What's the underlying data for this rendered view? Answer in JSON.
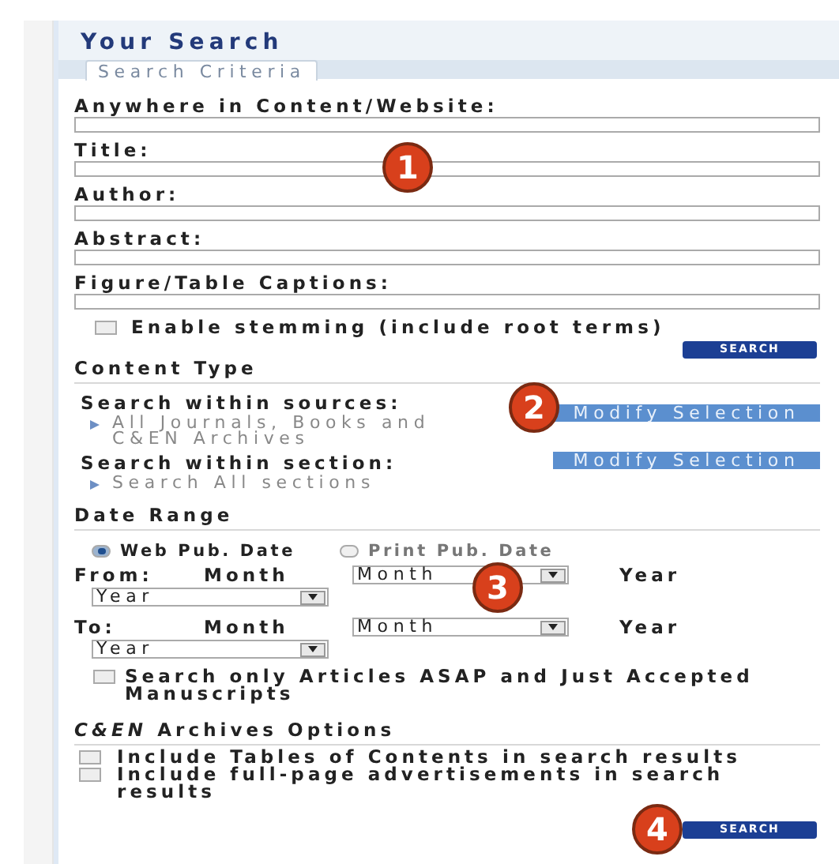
{
  "header": {
    "title": "Your Search"
  },
  "tabs": [
    {
      "label": "Search Criteria",
      "selected": true
    }
  ],
  "fields": [
    {
      "label": "Anywhere in Content/Website:"
    },
    {
      "label": "Title:"
    },
    {
      "label": "Author:"
    },
    {
      "label": "Abstract:"
    },
    {
      "label": "Figure/Table Captions:"
    }
  ],
  "stemming": {
    "label": "Enable stemming (include root terms)",
    "checked": false
  },
  "search_button": "SEARCH",
  "content_type": {
    "heading": "Content Type",
    "groups": [
      {
        "label": "Search within sources:",
        "button": "Modify Selection",
        "items": [
          "All Journals, Books and C&EN Archives"
        ]
      },
      {
        "label": "Search within section:",
        "button": "Modify Selection",
        "items": [
          "Search All sections"
        ]
      }
    ]
  },
  "date_range": {
    "heading": "Date Range",
    "radios": [
      {
        "label": "Web Pub. Date",
        "selected": true
      },
      {
        "label": "Print Pub. Date",
        "selected": false
      }
    ],
    "rows": [
      {
        "label": "From:",
        "month_label": "Month",
        "month_value": "Month",
        "year_label": "Year",
        "year_value": "Year"
      },
      {
        "label": "To:",
        "month_label": "Month",
        "month_value": "Month",
        "year_label": "Year",
        "year_value": "Year"
      }
    ]
  },
  "asap": {
    "label": "Search only Articles ASAP and Just Accepted Manuscripts",
    "checked": false
  },
  "archives": {
    "heading": "*C&EN* Archives Options",
    "options": [
      {
        "label": "Include Tables of Contents in search results",
        "checked": false
      },
      {
        "label": "Include full-page advertisements in search results",
        "checked": false
      }
    ]
  },
  "bottom_search_button": "SEARCH",
  "callouts": [
    "1",
    "2",
    "3",
    "4"
  ]
}
